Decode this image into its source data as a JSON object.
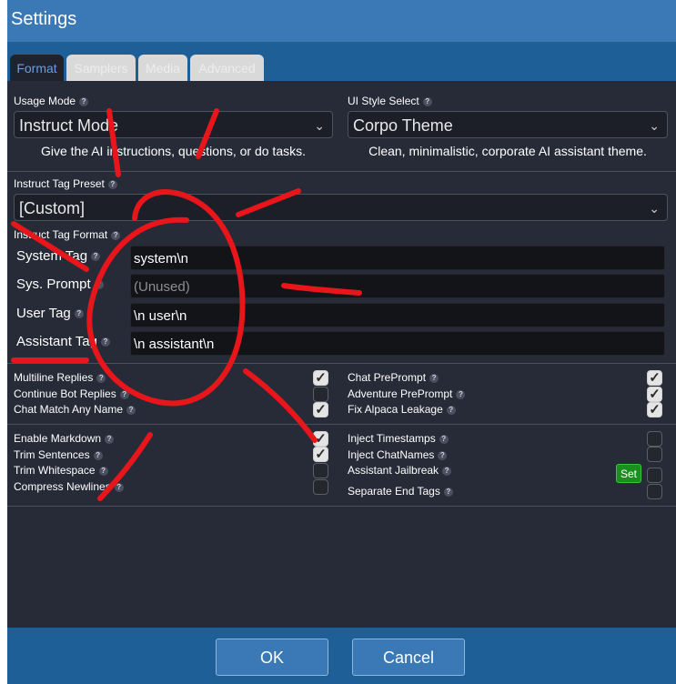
{
  "window": {
    "title": "Settings"
  },
  "tabs": [
    {
      "label": "Format",
      "active": true
    },
    {
      "label": "Samplers",
      "active": false
    },
    {
      "label": "Media",
      "active": false
    },
    {
      "label": "Advanced",
      "active": false
    }
  ],
  "usage_mode": {
    "label": "Usage Mode",
    "value": "Instruct Mode",
    "description": "Give the AI instructions, questions, or do tasks."
  },
  "ui_style": {
    "label": "UI Style Select",
    "value": "Corpo Theme",
    "description": "Clean, minimalistic, corporate AI assistant theme."
  },
  "instruct_preset": {
    "label": "Instruct Tag Preset",
    "value": "[Custom]"
  },
  "instruct_format": {
    "label": "Instruct Tag Format",
    "fields": [
      {
        "name": "System Tag",
        "value": "system\\n",
        "placeholder": ""
      },
      {
        "name": "Sys. Prompt",
        "value": "",
        "placeholder": "(Unused)"
      },
      {
        "name": "User Tag",
        "value": "\\n user\\n",
        "placeholder": ""
      },
      {
        "name": "Assistant Tag",
        "value": "\\n assistant\\n",
        "placeholder": ""
      }
    ]
  },
  "options_group1": {
    "left": [
      {
        "label": "Multiline Replies",
        "checked": true
      },
      {
        "label": "Continue Bot Replies",
        "checked": false
      },
      {
        "label": "Chat Match Any Name",
        "checked": true
      }
    ],
    "right": [
      {
        "label": "Chat PrePrompt",
        "checked": true
      },
      {
        "label": "Adventure PrePrompt",
        "checked": true
      },
      {
        "label": "Fix Alpaca Leakage",
        "checked": true
      }
    ]
  },
  "options_group2": {
    "left": [
      {
        "label": "Enable Markdown",
        "checked": true
      },
      {
        "label": "Trim Sentences",
        "checked": true
      },
      {
        "label": "Trim Whitespace",
        "checked": false
      },
      {
        "label": "Compress Newlines",
        "checked": false
      }
    ],
    "right": [
      {
        "label": "Inject Timestamps",
        "checked": false
      },
      {
        "label": "Inject ChatNames",
        "checked": false
      },
      {
        "label": "Assistant Jailbreak",
        "checked": false
      },
      {
        "label": "Separate End Tags",
        "checked": false
      }
    ],
    "set_button": "Set"
  },
  "help_glyph": "?",
  "check_glyph": "✓",
  "chevron_glyph": "⌄",
  "footer": {
    "ok": "OK",
    "cancel": "Cancel"
  },
  "colors": {
    "titlebar": "#3a78b6",
    "tabbar": "#1f5f97",
    "panel": "#272b38",
    "annotation": "#e8161b"
  }
}
